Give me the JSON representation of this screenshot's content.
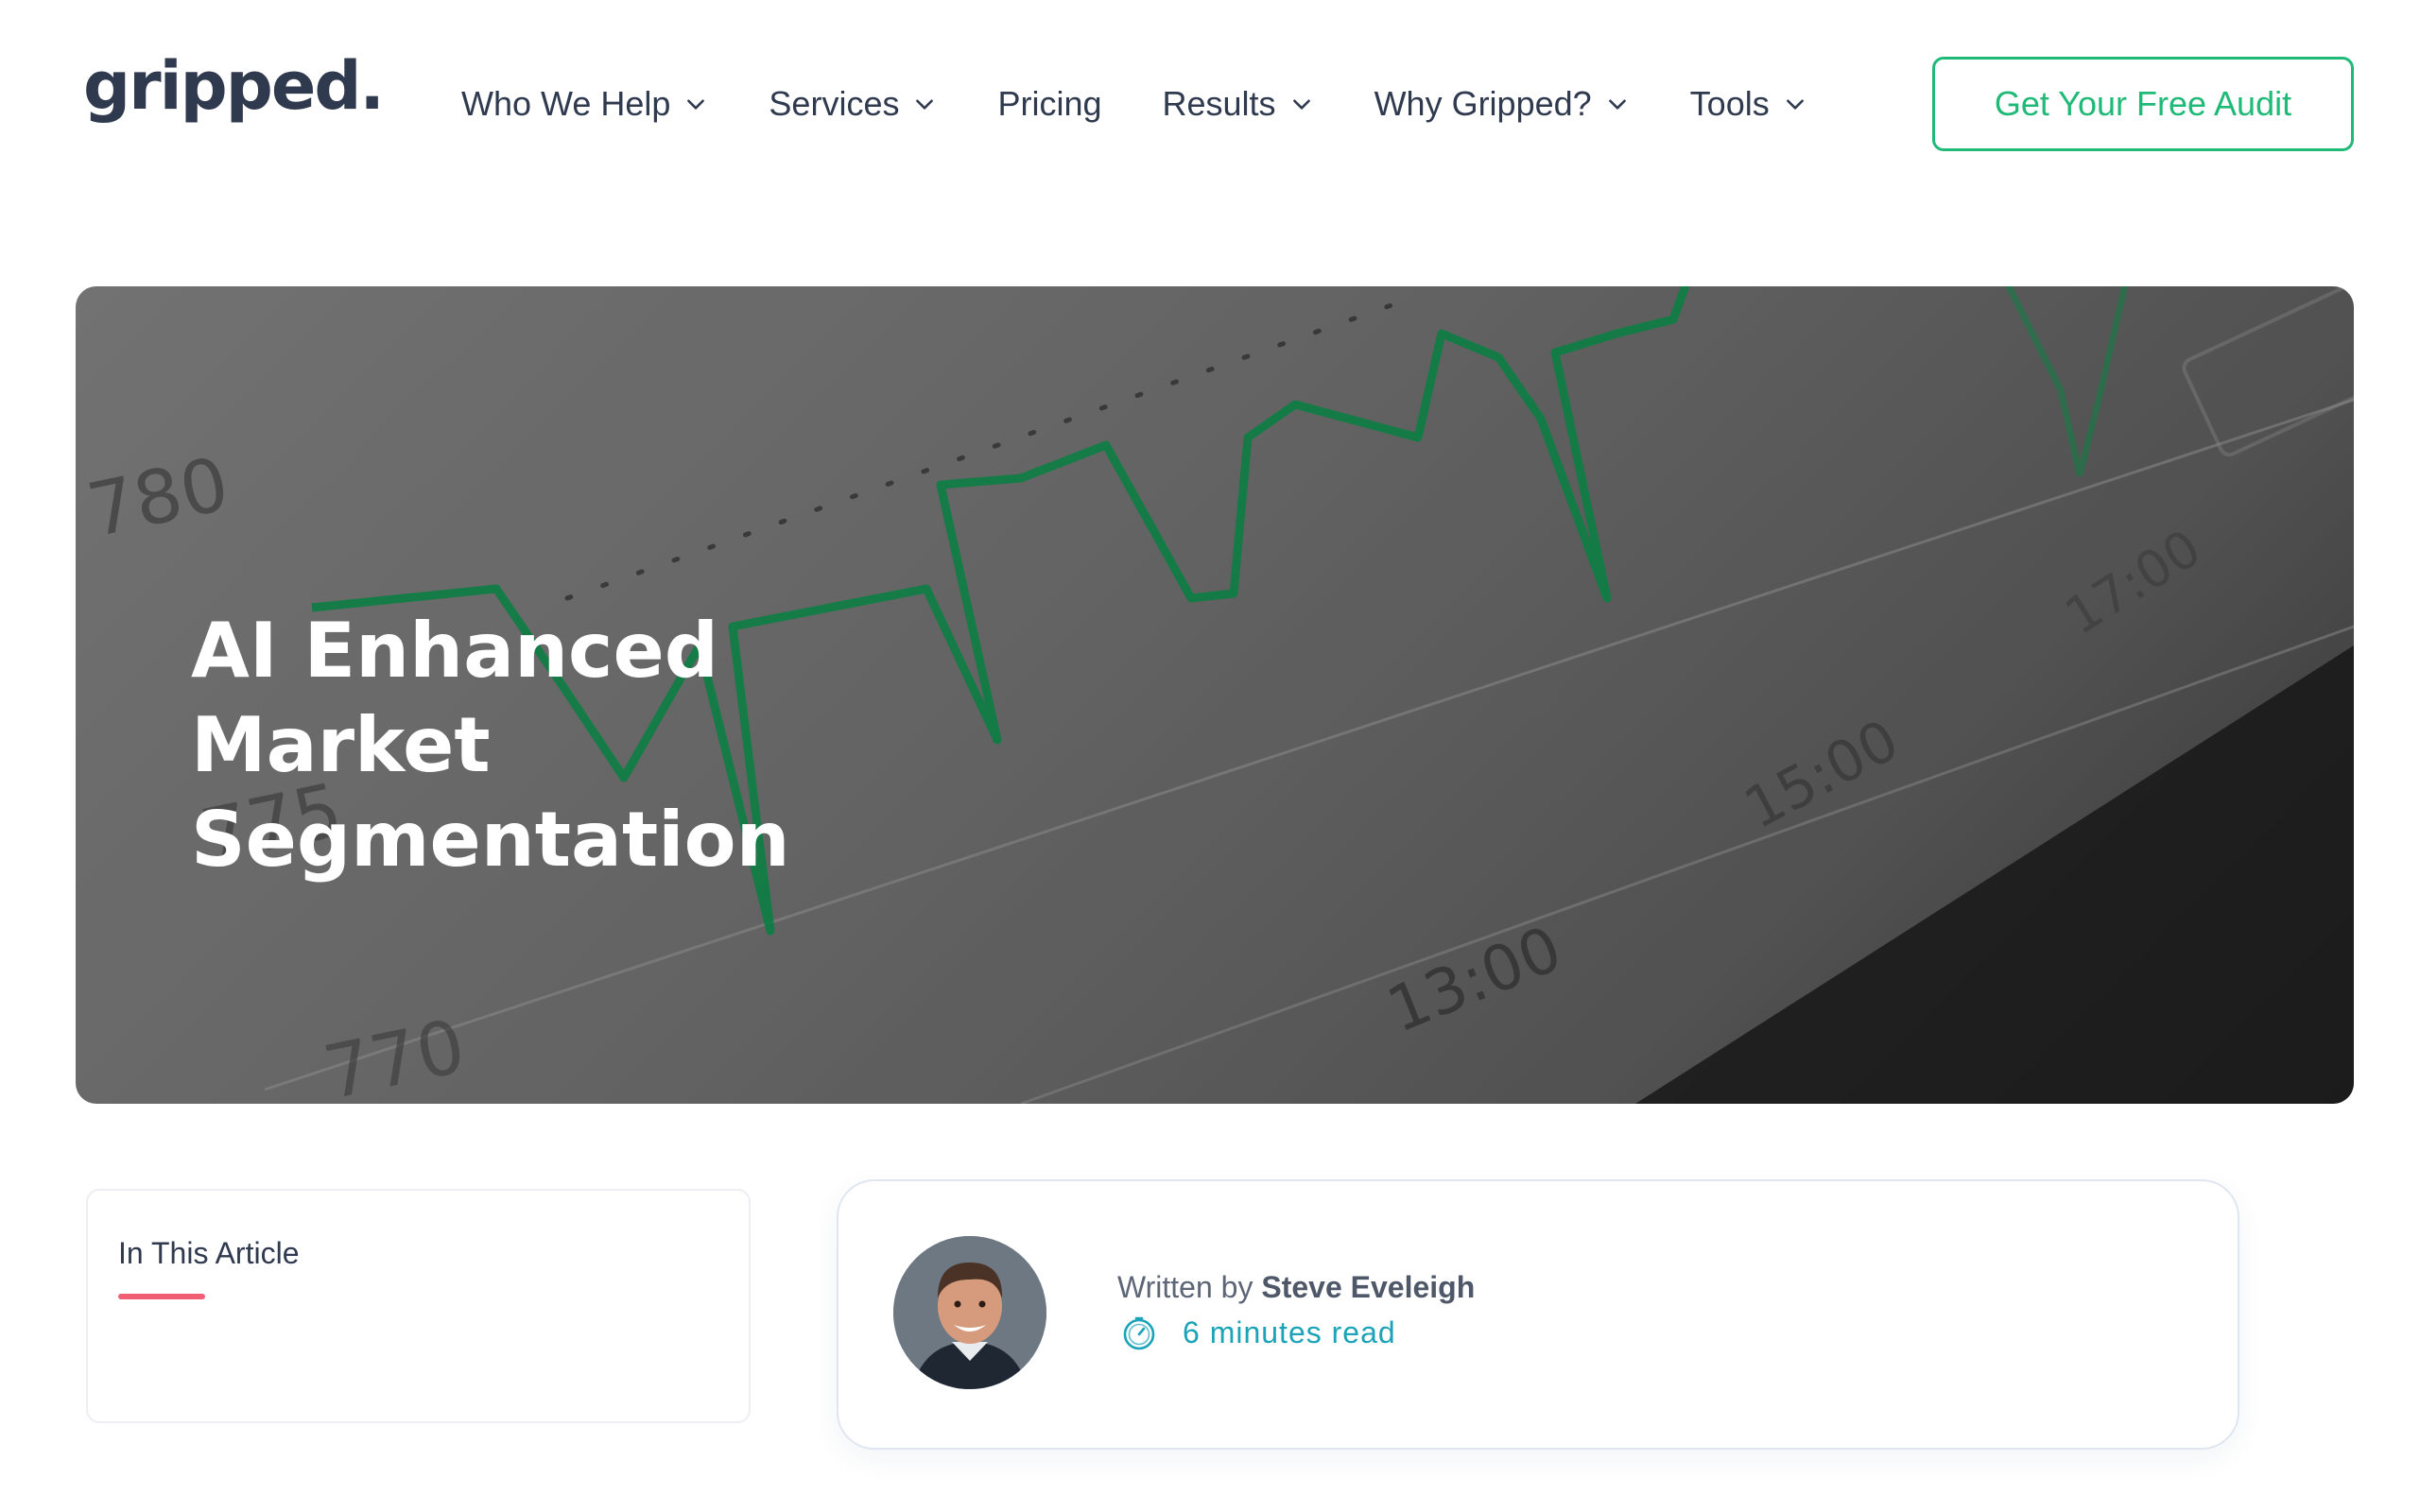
{
  "header": {
    "logo_text": "gripped.",
    "nav": [
      {
        "label": "Who We Help",
        "has_dropdown": true,
        "icon": "chevron-down-icon"
      },
      {
        "label": "Services",
        "has_dropdown": true,
        "icon": "chevron-down-icon"
      },
      {
        "label": "Pricing",
        "has_dropdown": false
      },
      {
        "label": "Results",
        "has_dropdown": true,
        "icon": "chevron-down-icon"
      },
      {
        "label": "Why Gripped?",
        "has_dropdown": true,
        "icon": "chevron-down-icon"
      },
      {
        "label": "Tools",
        "has_dropdown": true,
        "icon": "chevron-down-icon"
      }
    ],
    "cta_label": "Get Your Free Audit"
  },
  "hero": {
    "title_line1": "AI Enhanced Market",
    "title_line2": "Segmentation",
    "image_texts": {
      "y_780": "780",
      "y_775": "775",
      "y_770": "770",
      "x_1300": "13:00",
      "x_1500": "15:00",
      "x_1700": "17:00"
    }
  },
  "toc": {
    "title": "In This Article"
  },
  "author": {
    "written_prefix": "Written by",
    "name": "Steve Eveleigh",
    "read_time": "6 minutes read",
    "read_icon": "clock-icon"
  },
  "colors": {
    "accent_green": "#1fb978",
    "text_dark": "#2f3a4f",
    "underline_red": "#f15f74",
    "read_teal": "#1ba3b8",
    "chart_line_green": "#0e8a4a"
  }
}
